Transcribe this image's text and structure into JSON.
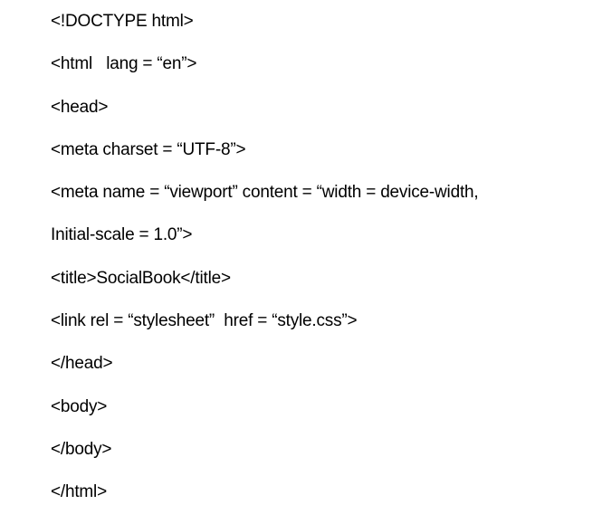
{
  "document": {
    "lines": [
      "<!DOCTYPE html>",
      "<html   lang = “en”>",
      "<head>",
      "<meta charset = “UTF-8”>",
      "<meta name = “viewport” content = “width = device-width,",
      "Initial-scale = 1.0”>",
      "<title>SocialBook</title>",
      "<link rel = “stylesheet”  href = “style.css”>",
      "</head>",
      "<body>",
      "</body>",
      "</html>"
    ]
  }
}
